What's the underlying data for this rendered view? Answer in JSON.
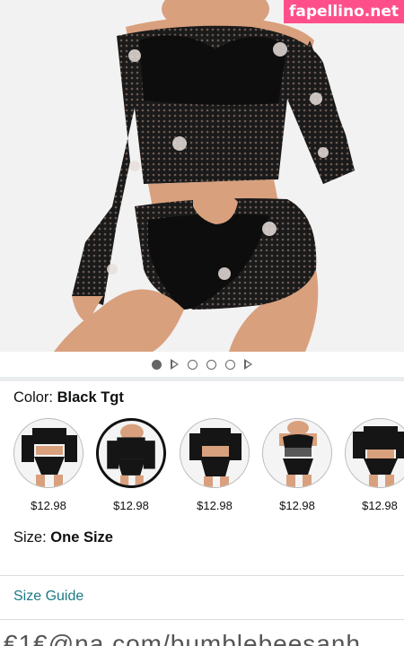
{
  "watermark": "fapellino.net",
  "carousel": {
    "items": [
      "image",
      "video",
      "image",
      "image",
      "image",
      "video"
    ],
    "active_index": 0
  },
  "color": {
    "label": "Color:",
    "value": "Black Tgt"
  },
  "swatches": [
    {
      "price": "$12.98",
      "selected": false
    },
    {
      "price": "$12.98",
      "selected": true
    },
    {
      "price": "$12.98",
      "selected": false
    },
    {
      "price": "$12.98",
      "selected": false
    },
    {
      "price": "$12.98",
      "selected": false
    }
  ],
  "size": {
    "label": "Size:",
    "value": "One Size"
  },
  "size_guide": "Size Guide",
  "bottom_watermark": "€1€@na.com/bumblebeesanh",
  "colors": {
    "link": "#1c7a84",
    "product": "#111111",
    "skin": "#d9a07e",
    "background": "#f2f2f2"
  }
}
